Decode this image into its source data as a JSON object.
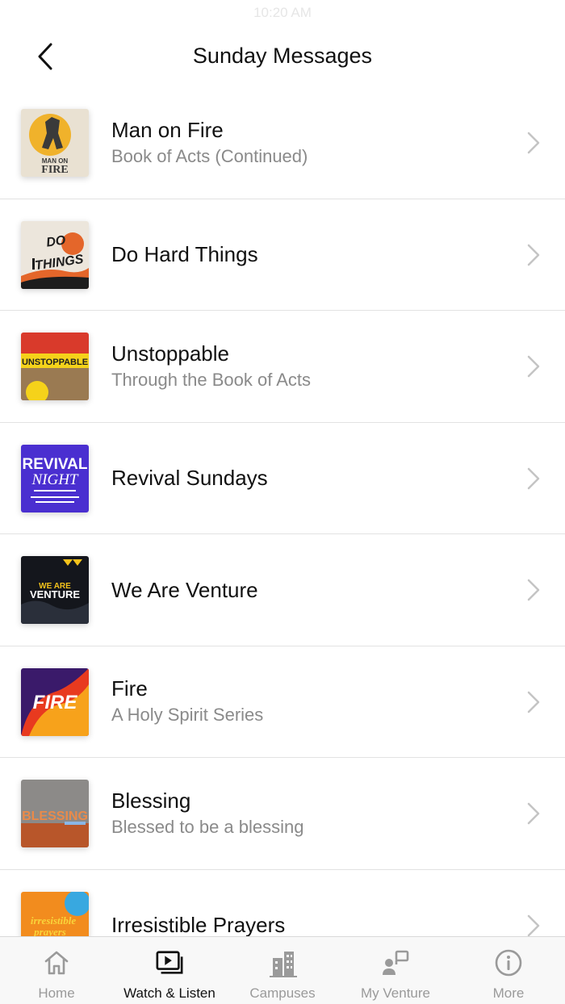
{
  "status": {
    "time": "10:20 AM"
  },
  "nav": {
    "title": "Sunday Messages"
  },
  "series": [
    {
      "title": "Man on Fire",
      "subtitle": "Book of Acts (Continued)",
      "art_text": "MAN ON FIRE",
      "colors": [
        "#e9e1d2",
        "#f0b22b",
        "#3a3a3a"
      ]
    },
    {
      "title": "Do Hard Things",
      "subtitle": "",
      "art_text": "DO HARD THINGS",
      "colors": [
        "#ece6dc",
        "#e4662a",
        "#1d1d1d"
      ]
    },
    {
      "title": "Unstoppable",
      "subtitle": "Through the Book of Acts",
      "art_text": "UNSTOPPABLE",
      "colors": [
        "#d93a2b",
        "#f5d21a",
        "#1e1e1e"
      ]
    },
    {
      "title": "Revival Sundays",
      "subtitle": "",
      "art_text": "REVIVAL NIGHT",
      "colors": [
        "#4a2fd0",
        "#ffffff",
        "#3520a8"
      ]
    },
    {
      "title": "We Are Venture",
      "subtitle": "",
      "art_text": "WE ARE VENTURE",
      "colors": [
        "#14161c",
        "#f3c21b",
        "#ffffff"
      ]
    },
    {
      "title": "Fire",
      "subtitle": "A Holy Spirit Series",
      "art_text": "FIRE",
      "colors": [
        "#e83a1f",
        "#f7a21b",
        "#3a1a6a"
      ]
    },
    {
      "title": "Blessing",
      "subtitle": "Blessed to be a blessing",
      "art_text": "BLESSING",
      "colors": [
        "#8c8a88",
        "#e98a4a",
        "#b8562a"
      ]
    },
    {
      "title": "Irresistible Prayers",
      "subtitle": "",
      "art_text": "irresistible prayers",
      "colors": [
        "#f28c1e",
        "#38a8e0",
        "#f9d43a"
      ]
    }
  ],
  "tabbar": {
    "tabs": [
      {
        "label": "Home",
        "icon": "home-icon"
      },
      {
        "label": "Watch & Listen",
        "icon": "play-library-icon"
      },
      {
        "label": "Campuses",
        "icon": "buildings-icon"
      },
      {
        "label": "My Venture",
        "icon": "person-card-icon"
      },
      {
        "label": "More",
        "icon": "info-icon"
      }
    ],
    "active_index": 1
  }
}
